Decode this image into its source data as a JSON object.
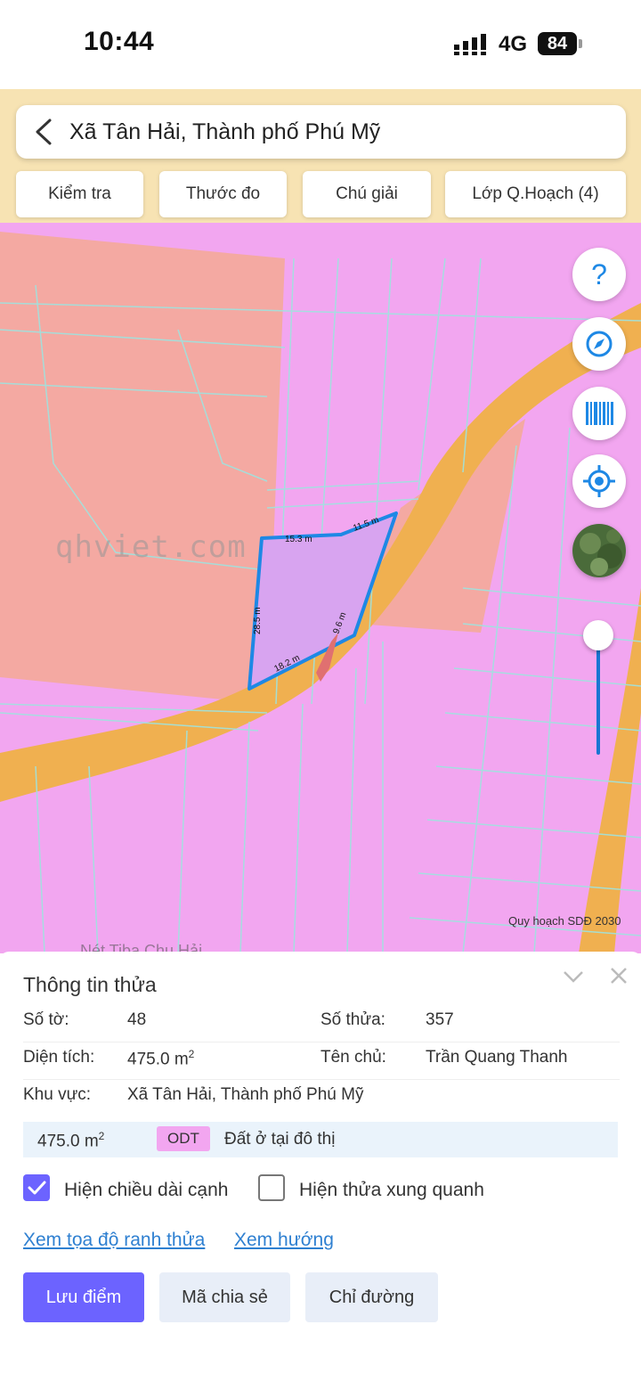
{
  "status_bar": {
    "time": "10:44",
    "network": "4G",
    "battery": "84"
  },
  "header": {
    "title": "Xã Tân Hải, Thành phố Phú Mỹ"
  },
  "toolbar": {
    "buttons": [
      "Kiểm tra",
      "Thước đo",
      "Chú giải",
      "Lớp Q.Hoạch (4)"
    ]
  },
  "map": {
    "watermark": "qhviet.com",
    "layer_label": "Quy hoạch SDĐ 2030",
    "poi_label": "Nét Tiba Chu Hải",
    "edges": [
      "15.3 m",
      "11.5 m",
      "28.5 m",
      "9.6 m",
      "18.2 m"
    ],
    "colors": {
      "residential": "#f2a6f0",
      "other": "#f4a9a2",
      "road": "#f0b050",
      "parcel": "#1e88e5",
      "selected_fill": "#d8a4f0"
    },
    "controls": {
      "help": "?",
      "icons": [
        "help-icon",
        "compass-icon",
        "barcode-icon",
        "locate-icon",
        "satellite-icon"
      ]
    }
  },
  "panel": {
    "title": "Thông tin thửa",
    "so_to_label": "Số tờ:",
    "so_to_value": "48",
    "so_thua_label": "Số thửa:",
    "so_thua_value": "357",
    "dien_tich_label": "Diện tích:",
    "dien_tich_value": "475.0 m",
    "ten_chu_label": "Tên chủ:",
    "ten_chu_value": "Trần Quang Thanh",
    "khu_vuc_label": "Khu vực:",
    "khu_vuc_value": "Xã Tân Hải, Thành phố Phú Mỹ",
    "land_area": "475.0 m",
    "land_code": "ODT",
    "land_desc": "Đất ở tại đô thị",
    "area_unit_power": "2",
    "show_edges_label": "Hiện chiều dài cạnh",
    "show_edges_checked": true,
    "show_neighbors_label": "Hiện thửa xung quanh",
    "show_neighbors_checked": false,
    "link_coords": "Xem tọa độ ranh thửa",
    "link_direction": "Xem hướng",
    "btn_save": "Lưu điểm",
    "btn_share": "Mã chia sẻ",
    "btn_route": "Chỉ đường"
  }
}
